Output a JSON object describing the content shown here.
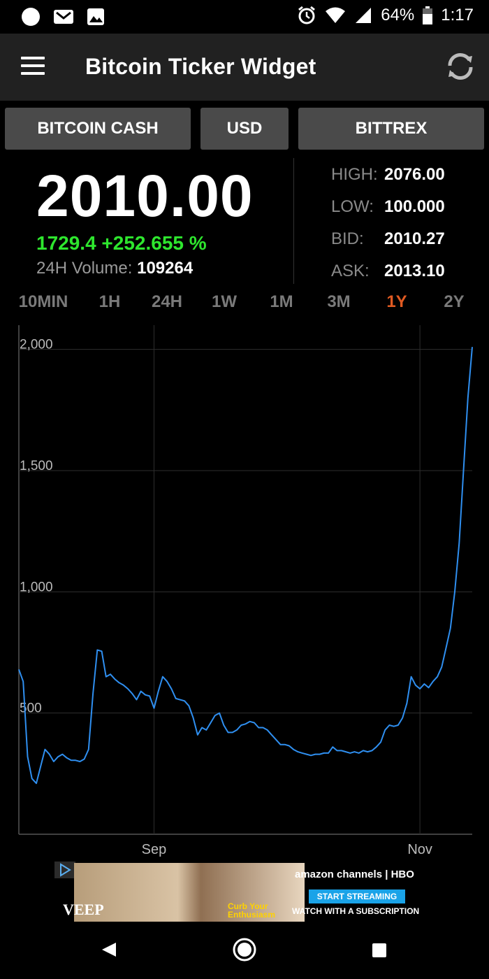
{
  "status_bar": {
    "battery": "64%",
    "time": "1:17"
  },
  "app": {
    "title": "Bitcoin Ticker Widget"
  },
  "selectors": {
    "coin": "BITCOIN CASH",
    "currency": "USD",
    "exchange": "BITTREX"
  },
  "ticker": {
    "price": "2010.00",
    "change": "1729.4 +252.655 %",
    "volume_label": "24H Volume:",
    "volume_value": "109264",
    "high_label": "HIGH:",
    "high_value": "2076.00",
    "low_label": "LOW:",
    "low_value": "100.000",
    "bid_label": "BID:",
    "bid_value": "2010.27",
    "ask_label": "ASK:",
    "ask_value": "2013.10"
  },
  "ranges": [
    "10MIN",
    "1H",
    "24H",
    "1W",
    "1M",
    "3M",
    "1Y",
    "2Y"
  ],
  "active_range": "1Y",
  "colors": {
    "accent": "#e05a22",
    "positive": "#2ee62e",
    "line": "#2f8ff0",
    "button": "#4a4a4a",
    "appbar": "#212121"
  },
  "ad": {
    "show1": "VEEP",
    "show2_line1": "Curb Your",
    "show2_line2": "Enthusiasm",
    "brand": "amazon channels  |  HBO",
    "cta": "START STREAMING",
    "tagline": "WATCH WITH A SUBSCRIPTION"
  },
  "chart_data": {
    "type": "line",
    "ylim": [
      0,
      2100
    ],
    "y_ticks": [
      500,
      1000,
      1500,
      2000
    ],
    "y_tick_labels": [
      "500",
      "1,000",
      "1,500",
      "2,000"
    ],
    "x_labels": [
      "Sep",
      "Nov"
    ],
    "grid": true,
    "series": [
      {
        "x": [
          "2017-08-01",
          "2017-08-02",
          "2017-08-03",
          "2017-08-04",
          "2017-08-05",
          "2017-08-06",
          "2017-08-07",
          "2017-08-08",
          "2017-08-09",
          "2017-08-10",
          "2017-08-11",
          "2017-08-12",
          "2017-08-13",
          "2017-08-14",
          "2017-08-15",
          "2017-08-16",
          "2017-08-17",
          "2017-08-18",
          "2017-08-19",
          "2017-08-20",
          "2017-08-21",
          "2017-08-22",
          "2017-08-23",
          "2017-08-24",
          "2017-08-25",
          "2017-08-26",
          "2017-08-27",
          "2017-08-28",
          "2017-08-29",
          "2017-08-30",
          "2017-08-31",
          "2017-09-01",
          "2017-09-02",
          "2017-09-03",
          "2017-09-04",
          "2017-09-05",
          "2017-09-06",
          "2017-09-07",
          "2017-09-08",
          "2017-09-09",
          "2017-09-10",
          "2017-09-11",
          "2017-09-12",
          "2017-09-13",
          "2017-09-14",
          "2017-09-15",
          "2017-09-16",
          "2017-09-17",
          "2017-09-18",
          "2017-09-19",
          "2017-09-20",
          "2017-09-21",
          "2017-09-22",
          "2017-09-23",
          "2017-09-24",
          "2017-09-25",
          "2017-09-26",
          "2017-09-27",
          "2017-09-28",
          "2017-09-29",
          "2017-09-30",
          "2017-10-01",
          "2017-10-02",
          "2017-10-03",
          "2017-10-04",
          "2017-10-05",
          "2017-10-06",
          "2017-10-07",
          "2017-10-08",
          "2017-10-09",
          "2017-10-10",
          "2017-10-11",
          "2017-10-12",
          "2017-10-13",
          "2017-10-14",
          "2017-10-15",
          "2017-10-16",
          "2017-10-17",
          "2017-10-18",
          "2017-10-19",
          "2017-10-20",
          "2017-10-21",
          "2017-10-22",
          "2017-10-23",
          "2017-10-24",
          "2017-10-25",
          "2017-10-26",
          "2017-10-27",
          "2017-10-28",
          "2017-10-29",
          "2017-10-30",
          "2017-10-31",
          "2017-11-01",
          "2017-11-02",
          "2017-11-03",
          "2017-11-04",
          "2017-11-05",
          "2017-11-06",
          "2017-11-07",
          "2017-11-08",
          "2017-11-09",
          "2017-11-10",
          "2017-11-11",
          "2017-11-12",
          "2017-11-13"
        ],
        "values": [
          680,
          630,
          320,
          230,
          210,
          280,
          350,
          330,
          300,
          320,
          330,
          315,
          305,
          305,
          300,
          310,
          350,
          580,
          760,
          755,
          650,
          660,
          640,
          625,
          615,
          600,
          580,
          555,
          590,
          575,
          570,
          520,
          590,
          650,
          630,
          600,
          560,
          555,
          550,
          530,
          480,
          410,
          440,
          430,
          460,
          490,
          500,
          450,
          420,
          420,
          430,
          450,
          455,
          465,
          460,
          440,
          440,
          430,
          410,
          390,
          370,
          370,
          365,
          350,
          340,
          335,
          330,
          325,
          330,
          330,
          335,
          335,
          360,
          345,
          345,
          340,
          335,
          340,
          335,
          345,
          340,
          345,
          360,
          380,
          430,
          450,
          445,
          450,
          480,
          540,
          650,
          615,
          600,
          620,
          605,
          630,
          650,
          690,
          770,
          850,
          1000,
          1200,
          1500,
          1800,
          2010
        ]
      }
    ]
  }
}
